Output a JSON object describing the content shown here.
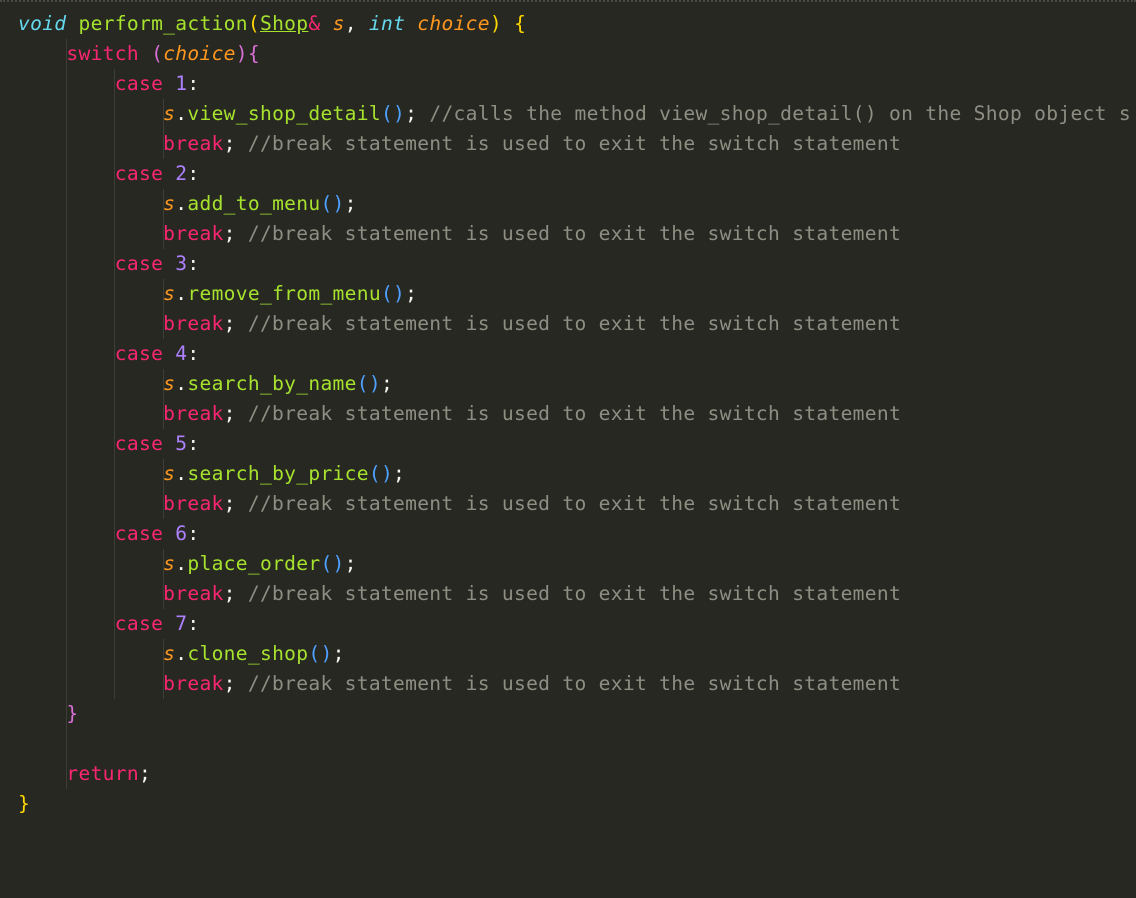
{
  "editor": {
    "lines": [
      [
        {
          "t": "void",
          "c": "type"
        },
        {
          "t": " "
        },
        {
          "t": "perform_action",
          "c": "fn"
        },
        {
          "t": "(",
          "c": "p1"
        },
        {
          "t": "Shop",
          "c": "fn ul"
        },
        {
          "t": "&",
          "c": "kw"
        },
        {
          "t": " "
        },
        {
          "t": "s",
          "c": "param"
        },
        {
          "t": ", "
        },
        {
          "t": "int",
          "c": "type"
        },
        {
          "t": " "
        },
        {
          "t": "choice",
          "c": "param"
        },
        {
          "t": ")",
          "c": "p1"
        },
        {
          "t": " "
        },
        {
          "t": "{",
          "c": "p1"
        }
      ],
      [
        {
          "t": "    "
        },
        {
          "t": "switch",
          "c": "kw"
        },
        {
          "t": " "
        },
        {
          "t": "(",
          "c": "p2"
        },
        {
          "t": "choice",
          "c": "param"
        },
        {
          "t": ")",
          "c": "p2"
        },
        {
          "t": "{",
          "c": "p2"
        }
      ],
      [
        {
          "t": "        "
        },
        {
          "t": "case",
          "c": "kw"
        },
        {
          "t": " "
        },
        {
          "t": "1",
          "c": "num"
        },
        {
          "t": ":"
        }
      ],
      [
        {
          "t": "            "
        },
        {
          "t": "s",
          "c": "param"
        },
        {
          "t": "."
        },
        {
          "t": "view_shop_detail",
          "c": "fn"
        },
        {
          "t": "()",
          "c": "p3"
        },
        {
          "t": "; "
        },
        {
          "t": "//calls the method view_shop_detail() on the Shop object s",
          "c": "cm"
        }
      ],
      [
        {
          "t": "            "
        },
        {
          "t": "break",
          "c": "kw"
        },
        {
          "t": "; "
        },
        {
          "t": "//break statement is used to exit the switch statement",
          "c": "cm"
        }
      ],
      [
        {
          "t": "        "
        },
        {
          "t": "case",
          "c": "kw"
        },
        {
          "t": " "
        },
        {
          "t": "2",
          "c": "num"
        },
        {
          "t": ":"
        }
      ],
      [
        {
          "t": "            "
        },
        {
          "t": "s",
          "c": "param"
        },
        {
          "t": "."
        },
        {
          "t": "add_to_menu",
          "c": "fn"
        },
        {
          "t": "()",
          "c": "p3"
        },
        {
          "t": ";"
        }
      ],
      [
        {
          "t": "            "
        },
        {
          "t": "break",
          "c": "kw"
        },
        {
          "t": "; "
        },
        {
          "t": "//break statement is used to exit the switch statement",
          "c": "cm"
        }
      ],
      [
        {
          "t": "        "
        },
        {
          "t": "case",
          "c": "kw"
        },
        {
          "t": " "
        },
        {
          "t": "3",
          "c": "num"
        },
        {
          "t": ":"
        }
      ],
      [
        {
          "t": "            "
        },
        {
          "t": "s",
          "c": "param"
        },
        {
          "t": "."
        },
        {
          "t": "remove_from_menu",
          "c": "fn"
        },
        {
          "t": "()",
          "c": "p3"
        },
        {
          "t": ";"
        }
      ],
      [
        {
          "t": "            "
        },
        {
          "t": "break",
          "c": "kw"
        },
        {
          "t": "; "
        },
        {
          "t": "//break statement is used to exit the switch statement",
          "c": "cm"
        }
      ],
      [
        {
          "t": "        "
        },
        {
          "t": "case",
          "c": "kw"
        },
        {
          "t": " "
        },
        {
          "t": "4",
          "c": "num"
        },
        {
          "t": ":"
        }
      ],
      [
        {
          "t": "            "
        },
        {
          "t": "s",
          "c": "param"
        },
        {
          "t": "."
        },
        {
          "t": "search_by_name",
          "c": "fn"
        },
        {
          "t": "()",
          "c": "p3"
        },
        {
          "t": ";"
        }
      ],
      [
        {
          "t": "            "
        },
        {
          "t": "break",
          "c": "kw"
        },
        {
          "t": "; "
        },
        {
          "t": "//break statement is used to exit the switch statement",
          "c": "cm"
        }
      ],
      [
        {
          "t": "        "
        },
        {
          "t": "case",
          "c": "kw"
        },
        {
          "t": " "
        },
        {
          "t": "5",
          "c": "num"
        },
        {
          "t": ":"
        }
      ],
      [
        {
          "t": "            "
        },
        {
          "t": "s",
          "c": "param"
        },
        {
          "t": "."
        },
        {
          "t": "search_by_price",
          "c": "fn"
        },
        {
          "t": "()",
          "c": "p3"
        },
        {
          "t": ";"
        }
      ],
      [
        {
          "t": "            "
        },
        {
          "t": "break",
          "c": "kw"
        },
        {
          "t": "; "
        },
        {
          "t": "//break statement is used to exit the switch statement",
          "c": "cm"
        }
      ],
      [
        {
          "t": "        "
        },
        {
          "t": "case",
          "c": "kw"
        },
        {
          "t": " "
        },
        {
          "t": "6",
          "c": "num"
        },
        {
          "t": ":"
        }
      ],
      [
        {
          "t": "            "
        },
        {
          "t": "s",
          "c": "param"
        },
        {
          "t": "."
        },
        {
          "t": "place_order",
          "c": "fn"
        },
        {
          "t": "()",
          "c": "p3"
        },
        {
          "t": ";"
        }
      ],
      [
        {
          "t": "            "
        },
        {
          "t": "break",
          "c": "kw"
        },
        {
          "t": "; "
        },
        {
          "t": "//break statement is used to exit the switch statement",
          "c": "cm"
        }
      ],
      [
        {
          "t": "        "
        },
        {
          "t": "case",
          "c": "kw"
        },
        {
          "t": " "
        },
        {
          "t": "7",
          "c": "num"
        },
        {
          "t": ":"
        }
      ],
      [
        {
          "t": "            "
        },
        {
          "t": "s",
          "c": "param"
        },
        {
          "t": "."
        },
        {
          "t": "clone_shop",
          "c": "fn"
        },
        {
          "t": "()",
          "c": "p3"
        },
        {
          "t": ";"
        }
      ],
      [
        {
          "t": "            "
        },
        {
          "t": "break",
          "c": "kw"
        },
        {
          "t": "; "
        },
        {
          "t": "//break statement is used to exit the switch statement",
          "c": "cm"
        }
      ],
      [
        {
          "t": "    "
        },
        {
          "t": "}",
          "c": "p2"
        }
      ],
      [
        {
          "t": ""
        }
      ],
      [
        {
          "t": "    "
        },
        {
          "t": "return",
          "c": "kw"
        },
        {
          "t": ";"
        }
      ],
      [
        {
          "t": "}",
          "c": "p1"
        }
      ]
    ],
    "guides": [
      [],
      [
        1
      ],
      [
        1,
        2
      ],
      [
        1,
        2,
        3
      ],
      [
        1,
        2,
        3
      ],
      [
        1,
        2
      ],
      [
        1,
        2,
        3
      ],
      [
        1,
        2,
        3
      ],
      [
        1,
        2
      ],
      [
        1,
        2,
        3
      ],
      [
        1,
        2,
        3
      ],
      [
        1,
        2
      ],
      [
        1,
        2,
        3
      ],
      [
        1,
        2,
        3
      ],
      [
        1,
        2
      ],
      [
        1,
        2,
        3
      ],
      [
        1,
        2,
        3
      ],
      [
        1,
        2
      ],
      [
        1,
        2,
        3
      ],
      [
        1,
        2,
        3
      ],
      [
        1,
        2
      ],
      [
        1,
        2,
        3
      ],
      [
        1,
        2,
        3
      ],
      [
        1
      ],
      [
        1
      ],
      [
        1
      ],
      []
    ]
  }
}
